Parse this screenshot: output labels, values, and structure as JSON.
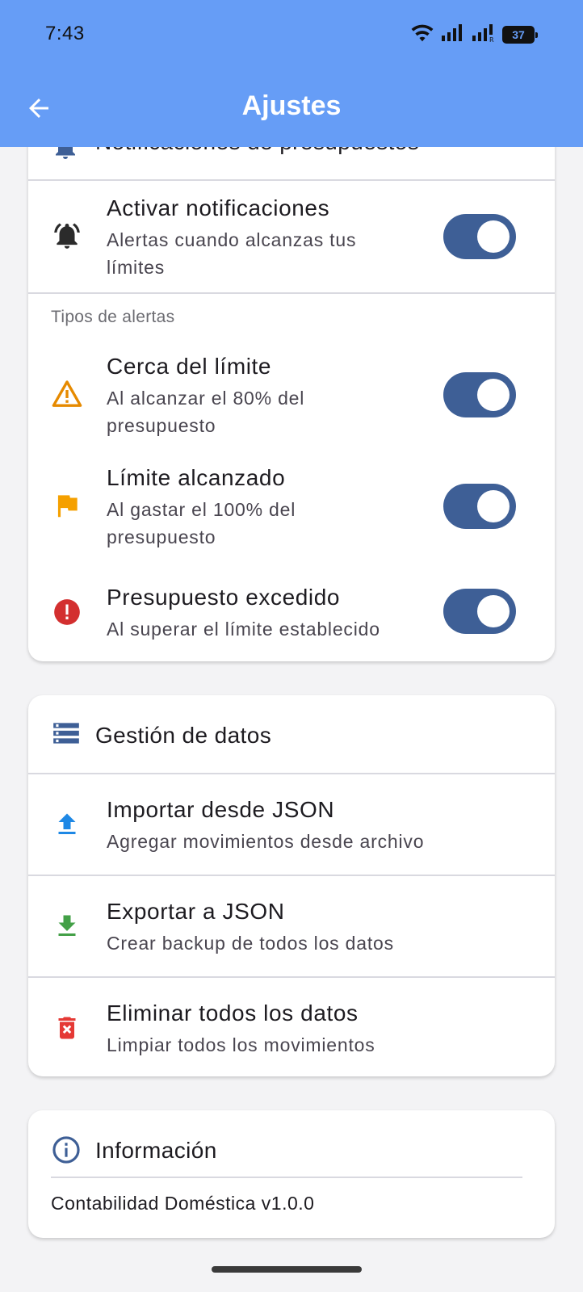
{
  "status_bar": {
    "time": "7:43",
    "battery": "37"
  },
  "header": {
    "title": "Ajustes"
  },
  "budget_card": {
    "title_partial": "Notificaciones de presupuestos",
    "activate": {
      "title": "Activar notificaciones",
      "subtitle_line1": "Alertas cuando alcanzas tus",
      "subtitle_line2": "límites",
      "enabled": true
    },
    "alert_types_label": "Tipos de alertas",
    "near_limit": {
      "title": "Cerca del límite",
      "subtitle_line1": "Al alcanzar el 80% del",
      "subtitle_line2": "presupuesto",
      "enabled": true
    },
    "limit_reached": {
      "title": "Límite alcanzado",
      "subtitle_line1": "Al gastar el 100% del",
      "subtitle_line2": "presupuesto",
      "enabled": true
    },
    "exceeded": {
      "title": "Presupuesto excedido",
      "subtitle": "Al superar el límite establecido",
      "enabled": true
    }
  },
  "data_card": {
    "title": "Gestión de datos",
    "import": {
      "title": "Importar desde JSON",
      "subtitle": "Agregar movimientos desde archivo"
    },
    "export": {
      "title": "Exportar a JSON",
      "subtitle": "Crear backup de todos los datos"
    },
    "delete": {
      "title": "Eliminar todos los datos",
      "subtitle": "Limpiar todos los movimientos"
    }
  },
  "info_card": {
    "title": "Información",
    "version": "Contabilidad Doméstica v1.0.0"
  },
  "colors": {
    "app_bar": "#669df6",
    "toggle_on": "#3e5f96",
    "warning": "#e68a00",
    "flag": "#f5a000",
    "error": "#d32f2f",
    "import_icon": "#1e88e5",
    "export_icon": "#43a047",
    "delete_icon": "#e53935"
  }
}
